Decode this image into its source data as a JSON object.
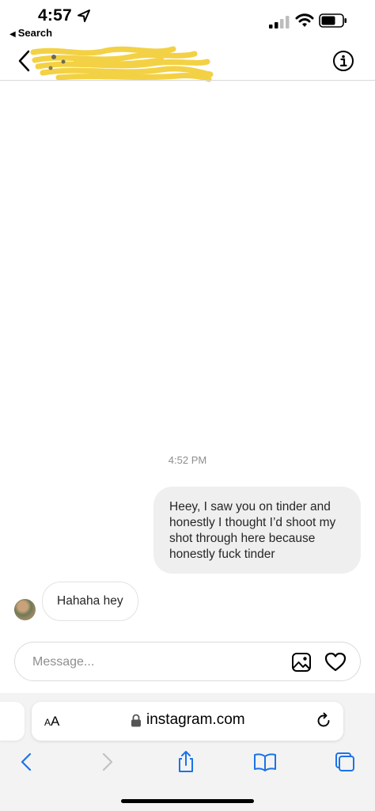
{
  "status_bar": {
    "time": "4:57",
    "back_app_label": "Search"
  },
  "header": {
    "contact_name": "",
    "name_redacted": true
  },
  "conversation": {
    "timestamp": "4:52 PM",
    "messages": [
      {
        "direction": "sent",
        "text": "Heey, I saw you on tinder and honestly I thought I’d shoot my shot through here because honestly fuck tinder"
      },
      {
        "direction": "received",
        "text": "Hahaha hey"
      }
    ]
  },
  "composer": {
    "placeholder": "Message..."
  },
  "browser": {
    "text_size_label_small": "A",
    "text_size_label_large": "A",
    "url": "instagram.com"
  },
  "colors": {
    "sent_bubble": "#efefef",
    "redaction": "#f3cf3a",
    "safari_accent": "#1a73e8"
  },
  "icons": [
    "location-arrow-icon",
    "signal-icon",
    "wifi-icon",
    "battery-icon",
    "back-chevron-icon",
    "info-icon",
    "gallery-icon",
    "heart-icon",
    "lock-icon",
    "reload-icon",
    "share-icon",
    "bookmarks-icon",
    "tabs-icon"
  ]
}
